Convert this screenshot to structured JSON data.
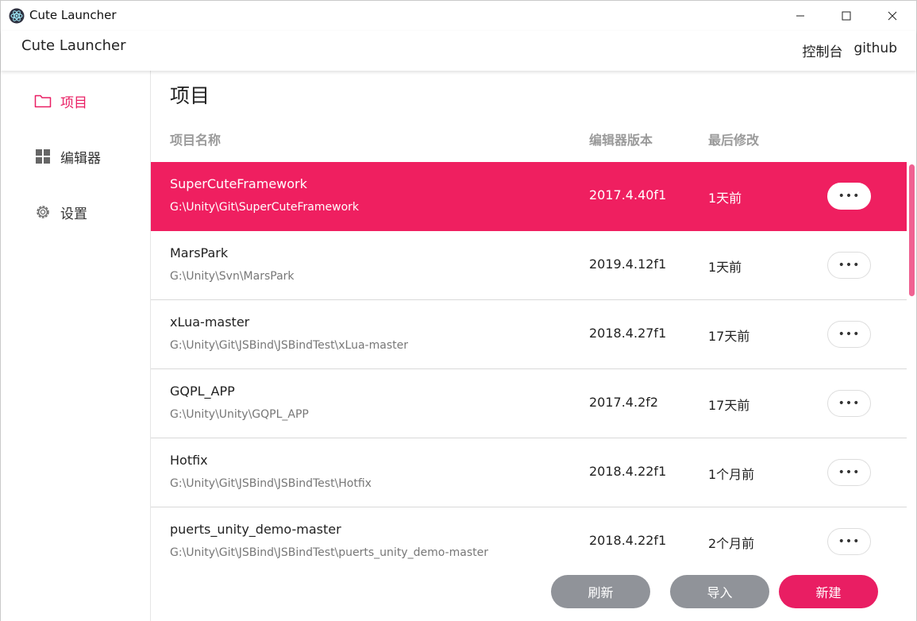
{
  "window": {
    "title": "Cute Launcher"
  },
  "header": {
    "app_name": "Cute Launcher",
    "links": [
      "控制台",
      "github"
    ]
  },
  "sidebar": {
    "items": [
      {
        "label": "项目",
        "icon": "folder-icon",
        "active": true
      },
      {
        "label": "编辑器",
        "icon": "grid-icon",
        "active": false
      },
      {
        "label": "设置",
        "icon": "gear-icon",
        "active": false
      }
    ]
  },
  "main": {
    "title": "项目",
    "columns": [
      "项目名称",
      "编辑器版本",
      "最后修改"
    ],
    "rows": [
      {
        "name": "SuperCuteFramework",
        "path": "G:\\Unity\\Git\\SuperCuteFramework",
        "version": "2017.4.40f1",
        "modified": "1天前",
        "more": "•••",
        "selected": true
      },
      {
        "name": "MarsPark",
        "path": "G:\\Unity\\Svn\\MarsPark",
        "version": "2019.4.12f1",
        "modified": "1天前",
        "more": "•••",
        "selected": false
      },
      {
        "name": "xLua-master",
        "path": "G:\\Unity\\Git\\JSBind\\JSBindTest\\xLua-master",
        "version": "2018.4.27f1",
        "modified": "17天前",
        "more": "•••",
        "selected": false
      },
      {
        "name": "GQPL_APP",
        "path": "G:\\Unity\\Unity\\GQPL_APP",
        "version": "2017.4.2f2",
        "modified": "17天前",
        "more": "•••",
        "selected": false
      },
      {
        "name": "Hotfix",
        "path": "G:\\Unity\\Git\\JSBind\\JSBindTest\\Hotfix",
        "version": "2018.4.22f1",
        "modified": "1个月前",
        "more": "•••",
        "selected": false
      },
      {
        "name": "puerts_unity_demo-master",
        "path": "G:\\Unity\\Git\\JSBind\\JSBindTest\\puerts_unity_demo-master",
        "version": "2018.4.22f1",
        "modified": "2个月前",
        "more": "•••",
        "selected": false
      }
    ]
  },
  "footer": {
    "refresh": "刷新",
    "import": "导入",
    "new": "新建"
  },
  "colors": {
    "accent": "#e91e63",
    "selected_row": "#ef1f60",
    "gray_button": "#909399"
  }
}
